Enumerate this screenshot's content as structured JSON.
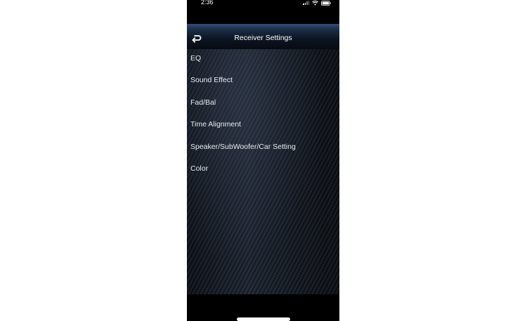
{
  "status_bar": {
    "time": "2:36"
  },
  "nav": {
    "title": "Receiver Settings",
    "back_icon": "back-return-icon"
  },
  "menu": {
    "items": [
      {
        "label": "EQ"
      },
      {
        "label": "Sound Effect"
      },
      {
        "label": "Fad/Bal"
      },
      {
        "label": "Time Alignment"
      },
      {
        "label": "Speaker/SubWoofer/Car Setting"
      },
      {
        "label": "Color"
      }
    ]
  },
  "colors": {
    "nav_accent": "#2f4d74",
    "text": "#e8ebef",
    "background": "#000000"
  }
}
